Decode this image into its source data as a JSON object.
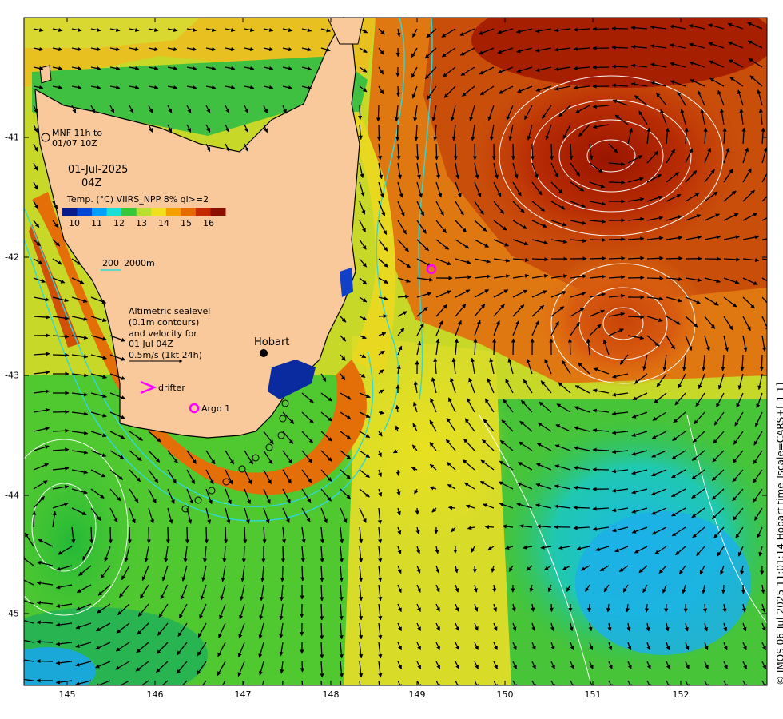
{
  "map": {
    "date_line": "01-Jul-2025",
    "time_line": "04Z",
    "mooring_label_1": "MNF 11h to",
    "mooring_label_2": "01/07 10Z",
    "colorbar_title": "Temp. (°C) VIIRS_NPP 8% ql>=2",
    "colorbar_ticks": [
      "10",
      "11",
      "12",
      "13",
      "14",
      "15",
      "16"
    ],
    "colorbar_colors": [
      "#0a1a8c",
      "#0047d6",
      "#00a0ff",
      "#18e0d6",
      "#36c83a",
      "#b8e030",
      "#f0e020",
      "#f5a000",
      "#e56a00",
      "#c42a00",
      "#8c1000"
    ],
    "isobath_legend_200": "200",
    "isobath_legend_2000": "2000m",
    "sealevel_note": "Altimetric sealevel\n(0.1m contours)\nand velocity for\n01 Jul 04Z\n0.5m/s (1kt 24h)",
    "drifter_label": "drifter",
    "argo_label": "Argo 1",
    "city_label": "Hobart",
    "side_text": "© IMOS 06-Jul-2025 11:01:14 Hobart time Tscale=CARS+[-1 1]",
    "x_ticks": [
      "145",
      "146",
      "147",
      "148",
      "149",
      "150",
      "151",
      "152"
    ],
    "y_ticks": [
      "-41",
      "-42",
      "-43",
      "-44",
      "-45"
    ],
    "colors": {
      "land": "#f9c99b",
      "warm": "#c23a08",
      "cool": "#2ec23a",
      "contour": "#ffffff",
      "isobath": "#30d8d8",
      "drifter": "#ff00ff"
    }
  }
}
